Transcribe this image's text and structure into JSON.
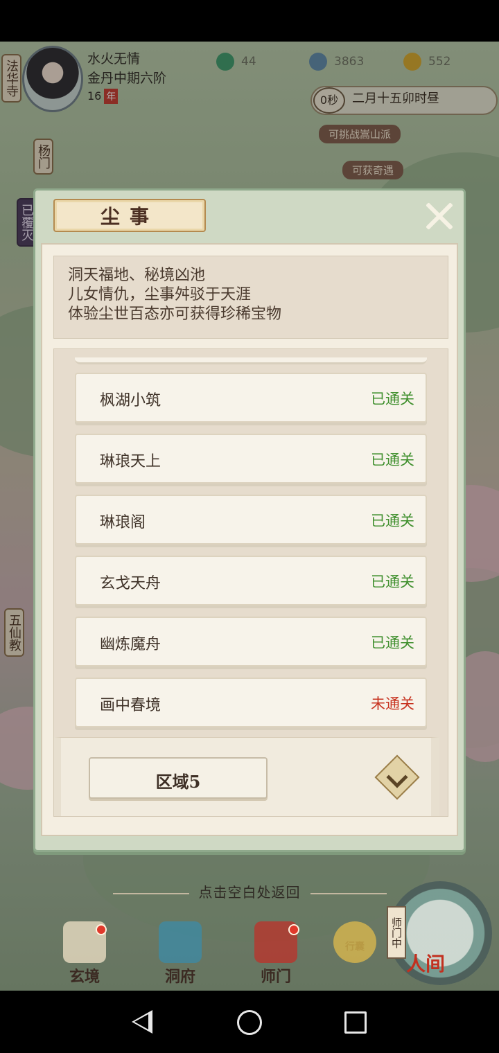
{
  "player": {
    "name": "水火无情",
    "rank": "金丹中期六阶",
    "age": "16",
    "age_unit": "年"
  },
  "resources": [
    {
      "icon": "spirit-vortex-icon",
      "value": "44",
      "color": "#3f9a6a"
    },
    {
      "icon": "spirit-coin-icon",
      "value": "3863",
      "color": "#5f8aa8"
    },
    {
      "icon": "merit-lotus-icon",
      "value": "552",
      "color": "#d4a72c"
    }
  ],
  "time": {
    "countdown": "0秒",
    "date": "二月十五卯时昼"
  },
  "side_tabs": [
    "法华寺",
    "杨门",
    "已覆灭",
    "五仙教"
  ],
  "map_tags": [
    "可挑战嵩山派",
    "可获奇遇"
  ],
  "panel": {
    "title": "尘事",
    "description": [
      "洞天福地、秘境凶池",
      "儿女情仇，尘事舛驳于天涯",
      "体验尘世百态亦可获得珍稀宝物"
    ],
    "items": [
      {
        "name": "枫湖小筑",
        "status": "已通关",
        "state": "done"
      },
      {
        "name": "琳琅天上",
        "status": "已通关",
        "state": "done"
      },
      {
        "name": "琳琅阁",
        "status": "已通关",
        "state": "done"
      },
      {
        "name": "玄戈天舟",
        "status": "已通关",
        "state": "done"
      },
      {
        "name": "幽炼魔舟",
        "status": "已通关",
        "state": "done"
      },
      {
        "name": "画中春境",
        "status": "未通关",
        "state": "todo"
      }
    ],
    "region": "区域5"
  },
  "hint": "点击空白处返回",
  "bottom_nav": [
    {
      "label": "玄境",
      "icon": "scroll-icon",
      "badge": true
    },
    {
      "label": "洞府",
      "icon": "pavilion-icon",
      "badge": false
    },
    {
      "label": "师门",
      "icon": "banner-icon",
      "badge": true
    },
    {
      "label": "行囊",
      "icon": "bag-icon",
      "badge": false
    }
  ],
  "human_world": {
    "label": "人间",
    "tag": "师门中"
  },
  "colors": {
    "done": "#3f8f2d",
    "todo": "#c7321f",
    "panel_border": "#8fa98c"
  }
}
